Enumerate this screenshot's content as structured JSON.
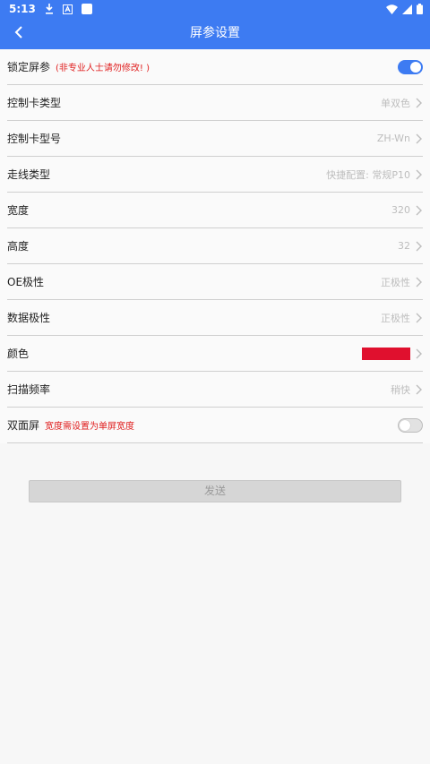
{
  "status_bar": {
    "time": "5:13",
    "icons_left": [
      "download-icon",
      "a-box-icon",
      "white-square-icon"
    ],
    "icons_right": [
      "wifi-icon",
      "cell-signal-icon",
      "battery-icon"
    ]
  },
  "app_bar": {
    "title": "屏参设置",
    "back_icon": "chevron-left-icon"
  },
  "rows": {
    "lock": {
      "label": "锁定屏参",
      "warning": "(非专业人士请勿修改! )",
      "toggle": true
    },
    "card_type": {
      "label": "控制卡类型",
      "value": "单双色"
    },
    "card_model": {
      "label": "控制卡型号",
      "value": "ZH-Wn"
    },
    "wiring": {
      "label": "走线类型",
      "value": "快捷配置: 常规P10"
    },
    "width": {
      "label": "宽度",
      "value": "320"
    },
    "height": {
      "label": "高度",
      "value": "32"
    },
    "oe": {
      "label": "OE极性",
      "value": "正极性"
    },
    "data_polarity": {
      "label": "数据极性",
      "value": "正极性"
    },
    "color": {
      "label": "颜色",
      "swatch": "#e0102e"
    },
    "scan_rate": {
      "label": "扫描频率",
      "value": "稍快"
    },
    "double_sided": {
      "label": "双面屏",
      "warning": "宽度需设置为单屏宽度",
      "toggle": false
    }
  },
  "send_button": {
    "label": "发送"
  },
  "colors": {
    "accent": "#3d7bf2",
    "warning": "#e02020",
    "swatch_red": "#e0102e"
  }
}
